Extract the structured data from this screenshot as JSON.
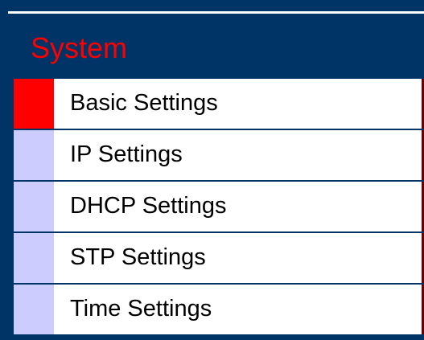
{
  "header": {
    "title": "System"
  },
  "menu": {
    "items": [
      {
        "label": "Basic Settings",
        "active": true
      },
      {
        "label": "IP Settings",
        "active": false
      },
      {
        "label": "DHCP Settings",
        "active": false
      },
      {
        "label": "STP Settings",
        "active": false
      },
      {
        "label": "Time Settings",
        "active": false
      }
    ]
  },
  "colors": {
    "header_bg": "#003366",
    "title_color": "#ff0000",
    "active_indicator": "#ff0000",
    "inactive_indicator": "#ccccff",
    "item_bg": "#ffffff",
    "item_text": "#000000"
  }
}
